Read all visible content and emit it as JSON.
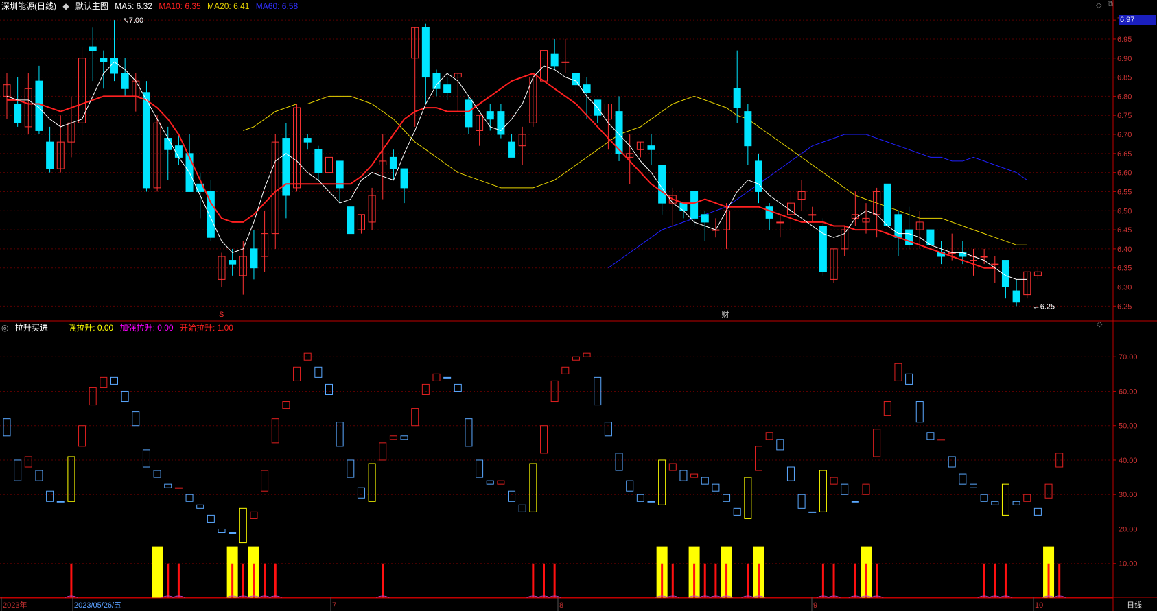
{
  "main_header": {
    "stock_name": "深圳能源(日线)",
    "template_icon": "diamond-icon",
    "template_label": "默认主图",
    "ma5": "MA5: 6.32",
    "ma10": "MA10: 6.35",
    "ma20": "MA20: 6.41",
    "ma60": "MA60: 6.58"
  },
  "indicator_header": {
    "name": "拉升买进",
    "strong": "强拉升: 0.00",
    "extra_strong": "加强拉升: 0.00",
    "start": "开始拉升: 1.00"
  },
  "colors": {
    "up": "#ff3333",
    "down": "#00e5ff",
    "ma5": "#ffffff",
    "ma10": "#ff2020",
    "ma20": "#e6d200",
    "ma60": "#2020ff",
    "ind_up": "#e02020",
    "ind_down": "#5aa8ff",
    "ind_yellow": "#ffff00",
    "ind_red": "#ff1010",
    "grid": "#5a0000",
    "axis": "#c00000",
    "label": "#cc3333"
  },
  "price_axis": {
    "labels": [
      "7.00",
      "6.95",
      "6.90",
      "6.85",
      "6.80",
      "6.75",
      "6.70",
      "6.65",
      "6.60",
      "6.55",
      "6.50",
      "6.45",
      "6.40",
      "6.35",
      "6.30",
      "6.25"
    ],
    "current_price": "6.97"
  },
  "indicator_axis": {
    "labels": [
      "70.00",
      "60.00",
      "50.00",
      "40.00",
      "30.00",
      "20.00",
      "10.00"
    ]
  },
  "annotations": {
    "high": "7.00",
    "low": "6.25",
    "marker_s": "S",
    "marker_cai": "财"
  },
  "date_axis": {
    "labels": [
      "2023年",
      "2023/05/26/五",
      "7",
      "8",
      "9",
      "10"
    ],
    "period": "日线"
  },
  "top_right_icons": [
    "diamond-icon",
    "restore-icon",
    "close-icon"
  ],
  "chart_data": {
    "type": "candlestick",
    "y_range": [
      6.22,
      7.02
    ],
    "candles_ohlc": [
      [
        6.8,
        6.86,
        6.74,
        6.83
      ],
      [
        6.78,
        6.85,
        6.72,
        6.73
      ],
      [
        6.72,
        6.86,
        6.7,
        6.82
      ],
      [
        6.84,
        6.88,
        6.7,
        6.71
      ],
      [
        6.68,
        6.72,
        6.6,
        6.61
      ],
      [
        6.61,
        6.75,
        6.6,
        6.68
      ],
      [
        6.68,
        6.8,
        6.64,
        6.73
      ],
      [
        6.73,
        6.93,
        6.7,
        6.9
      ],
      [
        6.93,
        6.98,
        6.84,
        6.92
      ],
      [
        6.9,
        6.92,
        6.82,
        6.89
      ],
      [
        6.9,
        7.0,
        6.84,
        6.86
      ],
      [
        6.86,
        6.9,
        6.8,
        6.82
      ],
      [
        6.8,
        6.86,
        6.76,
        6.84
      ],
      [
        6.81,
        6.84,
        6.55,
        6.56
      ],
      [
        6.56,
        6.75,
        6.55,
        6.73
      ],
      [
        6.69,
        6.72,
        6.58,
        6.66
      ],
      [
        6.67,
        6.7,
        6.62,
        6.64
      ],
      [
        6.65,
        6.7,
        6.56,
        6.55
      ],
      [
        6.57,
        6.6,
        6.48,
        6.55
      ],
      [
        6.55,
        6.58,
        6.42,
        6.43
      ],
      [
        6.32,
        6.39,
        6.3,
        6.38
      ],
      [
        6.37,
        6.4,
        6.33,
        6.36
      ],
      [
        6.33,
        6.42,
        6.28,
        6.38
      ],
      [
        6.4,
        6.45,
        6.32,
        6.35
      ],
      [
        6.38,
        6.5,
        6.34,
        6.44
      ],
      [
        6.44,
        6.7,
        6.4,
        6.68
      ],
      [
        6.69,
        6.73,
        6.48,
        6.54
      ],
      [
        6.56,
        6.78,
        6.55,
        6.77
      ],
      [
        6.69,
        6.7,
        6.66,
        6.68
      ],
      [
        6.66,
        6.67,
        6.58,
        6.6
      ],
      [
        6.6,
        6.65,
        6.52,
        6.64
      ],
      [
        6.63,
        6.63,
        6.52,
        6.56
      ],
      [
        6.51,
        6.51,
        6.44,
        6.44
      ],
      [
        6.45,
        6.49,
        6.44,
        6.49
      ],
      [
        6.47,
        6.56,
        6.45,
        6.54
      ],
      [
        6.62,
        6.7,
        6.53,
        6.63
      ],
      [
        6.64,
        6.66,
        6.58,
        6.61
      ],
      [
        6.61,
        6.61,
        6.52,
        6.56
      ],
      [
        6.9,
        6.98,
        6.72,
        6.98
      ],
      [
        6.98,
        6.99,
        6.78,
        6.85
      ],
      [
        6.86,
        6.87,
        6.8,
        6.82
      ],
      [
        6.83,
        6.85,
        6.79,
        6.81
      ],
      [
        6.85,
        6.86,
        6.76,
        6.86
      ],
      [
        6.79,
        6.8,
        6.7,
        6.72
      ],
      [
        6.71,
        6.75,
        6.67,
        6.75
      ],
      [
        6.76,
        6.78,
        6.71,
        6.74
      ],
      [
        6.76,
        6.78,
        6.69,
        6.7
      ],
      [
        6.68,
        6.7,
        6.64,
        6.64
      ],
      [
        6.67,
        6.72,
        6.62,
        6.7
      ],
      [
        6.73,
        6.86,
        6.72,
        6.85
      ],
      [
        6.84,
        6.94,
        6.82,
        6.92
      ],
      [
        6.91,
        6.95,
        6.87,
        6.88
      ],
      [
        6.89,
        6.95,
        6.86,
        6.89
      ],
      [
        6.86,
        6.84,
        6.81,
        6.83
      ],
      [
        6.83,
        6.85,
        6.74,
        6.81
      ],
      [
        6.79,
        6.78,
        6.73,
        6.75
      ],
      [
        6.74,
        6.78,
        6.66,
        6.78
      ],
      [
        6.76,
        6.8,
        6.63,
        6.65
      ],
      [
        6.64,
        6.7,
        6.57,
        6.65
      ],
      [
        6.66,
        6.68,
        6.64,
        6.68
      ],
      [
        6.67,
        6.7,
        6.62,
        6.66
      ],
      [
        6.62,
        6.6,
        6.49,
        6.52
      ],
      [
        6.52,
        6.56,
        6.46,
        6.54
      ],
      [
        6.52,
        6.51,
        6.48,
        6.5
      ],
      [
        6.55,
        6.55,
        6.46,
        6.48
      ],
      [
        6.49,
        6.5,
        6.42,
        6.47
      ],
      [
        6.45,
        6.48,
        6.43,
        6.45
      ],
      [
        6.45,
        6.52,
        6.4,
        6.5
      ],
      [
        6.82,
        6.92,
        6.73,
        6.77
      ],
      [
        6.76,
        6.78,
        6.62,
        6.67
      ],
      [
        6.63,
        6.65,
        6.52,
        6.55
      ],
      [
        6.51,
        6.52,
        6.45,
        6.48
      ],
      [
        6.47,
        6.49,
        6.43,
        6.47
      ],
      [
        6.49,
        6.55,
        6.45,
        6.52
      ],
      [
        6.53,
        6.58,
        6.5,
        6.55
      ],
      [
        6.49,
        6.51,
        6.47,
        6.49
      ],
      [
        6.46,
        6.48,
        6.33,
        6.34
      ],
      [
        6.32,
        6.4,
        6.31,
        6.4
      ],
      [
        6.4,
        6.46,
        6.38,
        6.45
      ],
      [
        6.48,
        6.55,
        6.46,
        6.49
      ],
      [
        6.47,
        6.52,
        6.44,
        6.48
      ],
      [
        6.49,
        6.56,
        6.43,
        6.55
      ],
      [
        6.57,
        6.57,
        6.47,
        6.46
      ],
      [
        6.49,
        6.5,
        6.38,
        6.43
      ],
      [
        6.45,
        6.51,
        6.4,
        6.41
      ],
      [
        6.45,
        6.5,
        6.4,
        6.47
      ],
      [
        6.45,
        6.45,
        6.41,
        6.41
      ],
      [
        6.39,
        6.42,
        6.36,
        6.38
      ],
      [
        6.39,
        6.44,
        6.37,
        6.39
      ],
      [
        6.39,
        6.42,
        6.36,
        6.38
      ],
      [
        6.37,
        6.4,
        6.33,
        6.38
      ],
      [
        6.38,
        6.4,
        6.36,
        6.38
      ],
      [
        6.36,
        6.38,
        6.31,
        6.36
      ],
      [
        6.37,
        6.37,
        6.27,
        6.3
      ],
      [
        6.29,
        6.32,
        6.25,
        6.26
      ],
      [
        6.28,
        6.34,
        6.27,
        6.34
      ],
      [
        6.33,
        6.35,
        6.32,
        6.34
      ]
    ],
    "ma5": [
      6.8,
      6.79,
      6.79,
      6.77,
      6.74,
      6.72,
      6.73,
      6.74,
      6.8,
      6.86,
      6.89,
      6.87,
      6.84,
      6.79,
      6.74,
      6.69,
      6.64,
      6.6,
      6.54,
      6.48,
      6.42,
      6.39,
      6.4,
      6.47,
      6.56,
      6.63,
      6.65,
      6.63,
      6.6,
      6.58,
      6.55,
      6.52,
      6.53,
      6.58,
      6.6,
      6.59,
      6.58,
      6.65,
      6.71,
      6.78,
      6.83,
      6.86,
      6.84,
      6.8,
      6.76,
      6.72,
      6.71,
      6.74,
      6.78,
      6.85,
      6.88,
      6.87,
      6.85,
      6.84,
      6.8,
      6.77,
      6.73,
      6.7,
      6.67,
      6.63,
      6.6,
      6.56,
      6.52,
      6.5,
      6.47,
      6.46,
      6.45,
      6.5,
      6.55,
      6.58,
      6.57,
      6.54,
      6.52,
      6.5,
      6.48,
      6.46,
      6.44,
      6.43,
      6.44,
      6.48,
      6.5,
      6.49,
      6.46,
      6.44,
      6.44,
      6.43,
      6.41,
      6.4,
      6.39,
      6.39,
      6.38,
      6.37,
      6.35,
      6.33,
      6.32,
      6.32
    ],
    "ma10": [
      6.79,
      6.79,
      6.78,
      6.78,
      6.77,
      6.76,
      6.77,
      6.78,
      6.79,
      6.8,
      6.8,
      6.8,
      6.8,
      6.79,
      6.77,
      6.74,
      6.7,
      6.64,
      6.58,
      6.52,
      6.48,
      6.47,
      6.47,
      6.49,
      6.52,
      6.55,
      6.57,
      6.57,
      6.57,
      6.57,
      6.57,
      6.57,
      6.57,
      6.59,
      6.62,
      6.66,
      6.7,
      6.74,
      6.76,
      6.77,
      6.77,
      6.76,
      6.76,
      6.76,
      6.78,
      6.8,
      6.82,
      6.84,
      6.85,
      6.86,
      6.84,
      6.82,
      6.8,
      6.78,
      6.75,
      6.72,
      6.69,
      6.66,
      6.63,
      6.6,
      6.57,
      6.55,
      6.53,
      6.52,
      6.52,
      6.53,
      6.52,
      6.51,
      6.51,
      6.51,
      6.51,
      6.5,
      6.49,
      6.48,
      6.47,
      6.47,
      6.47,
      6.46,
      6.46,
      6.45,
      6.45,
      6.45,
      6.44,
      6.43,
      6.42,
      6.41,
      6.4,
      6.39,
      6.38,
      6.37,
      6.36,
      6.35,
      6.35
    ],
    "ma20": [
      6.71,
      6.72,
      6.74,
      6.76,
      6.77,
      6.78,
      6.78,
      6.79,
      6.8,
      6.8,
      6.8,
      6.79,
      6.78,
      6.76,
      6.74,
      6.71,
      6.68,
      6.66,
      6.64,
      6.62,
      6.6,
      6.59,
      6.58,
      6.57,
      6.56,
      6.56,
      6.56,
      6.56,
      6.57,
      6.58,
      6.6,
      6.62,
      6.64,
      6.66,
      6.68,
      6.7,
      6.71,
      6.72,
      6.74,
      6.76,
      6.78,
      6.79,
      6.8,
      6.79,
      6.78,
      6.77,
      6.75,
      6.74,
      6.72,
      6.7,
      6.68,
      6.66,
      6.64,
      6.62,
      6.6,
      6.58,
      6.56,
      6.54,
      6.53,
      6.52,
      6.51,
      6.5,
      6.49,
      6.48,
      6.48,
      6.48,
      6.47,
      6.46,
      6.45,
      6.44,
      6.43,
      6.42,
      6.41,
      6.41
    ],
    "ma60": [
      6.35,
      6.37,
      6.39,
      6.41,
      6.43,
      6.45,
      6.46,
      6.47,
      6.48,
      6.49,
      6.5,
      6.51,
      6.53,
      6.55,
      6.57,
      6.59,
      6.61,
      6.63,
      6.65,
      6.67,
      6.68,
      6.69,
      6.7,
      6.7,
      6.7,
      6.69,
      6.68,
      6.67,
      6.66,
      6.65,
      6.64,
      6.64,
      6.63,
      6.63,
      6.64,
      6.63,
      6.62,
      6.61,
      6.6,
      6.58
    ],
    "indicator": {
      "y_range": [
        0,
        78
      ],
      "boxes_open_close_kind": [
        [
          52,
          47,
          "d"
        ],
        [
          34,
          40,
          "d"
        ],
        [
          41,
          38,
          "u"
        ],
        [
          37,
          34,
          "d"
        ],
        [
          31,
          28,
          "d"
        ],
        [
          28,
          28,
          "d"
        ],
        [
          28,
          41,
          "y"
        ],
        [
          44,
          50,
          "u"
        ],
        [
          56,
          61,
          "u"
        ],
        [
          61,
          64,
          "u"
        ],
        [
          64,
          62,
          "d"
        ],
        [
          60,
          57,
          "d"
        ],
        [
          54,
          50,
          "d"
        ],
        [
          43,
          38,
          "d"
        ],
        [
          37,
          35,
          "d"
        ],
        [
          33,
          32,
          "d"
        ],
        [
          32,
          32,
          "u"
        ],
        [
          30,
          28,
          "d"
        ],
        [
          27,
          26,
          "d"
        ],
        [
          24,
          22,
          "d"
        ],
        [
          20,
          19,
          "d"
        ],
        [
          19,
          19,
          "d"
        ],
        [
          16,
          26,
          "y"
        ],
        [
          23,
          25,
          "u"
        ],
        [
          31,
          37,
          "u"
        ],
        [
          45,
          52,
          "u"
        ],
        [
          55,
          57,
          "u"
        ],
        [
          63,
          67,
          "u"
        ],
        [
          69,
          71,
          "u"
        ],
        [
          67,
          64,
          "d"
        ],
        [
          62,
          59,
          "d"
        ],
        [
          51,
          44,
          "d"
        ],
        [
          40,
          35,
          "d"
        ],
        [
          32,
          29,
          "d"
        ],
        [
          28,
          39,
          "y"
        ],
        [
          40,
          45,
          "u"
        ],
        [
          46,
          47,
          "u"
        ],
        [
          47,
          46,
          "d"
        ],
        [
          50,
          55,
          "u"
        ],
        [
          59,
          62,
          "u"
        ],
        [
          63,
          65,
          "u"
        ],
        [
          64,
          64,
          "d"
        ],
        [
          62,
          60,
          "d"
        ],
        [
          52,
          44,
          "d"
        ],
        [
          40,
          35,
          "d"
        ],
        [
          34,
          33,
          "d"
        ],
        [
          33,
          34,
          "u"
        ],
        [
          31,
          28,
          "d"
        ],
        [
          27,
          25,
          "d"
        ],
        [
          25,
          39,
          "y"
        ],
        [
          42,
          50,
          "u"
        ],
        [
          57,
          63,
          "u"
        ],
        [
          65,
          67,
          "u"
        ],
        [
          69,
          70,
          "u"
        ],
        [
          70,
          71,
          "u"
        ],
        [
          64,
          56,
          "d"
        ],
        [
          51,
          47,
          "d"
        ],
        [
          42,
          37,
          "d"
        ],
        [
          34,
          31,
          "d"
        ],
        [
          30,
          28,
          "d"
        ],
        [
          28,
          28,
          "d"
        ],
        [
          27,
          40,
          "y"
        ],
        [
          37,
          39,
          "u"
        ],
        [
          37,
          34,
          "d"
        ],
        [
          35,
          36,
          "u"
        ],
        [
          35,
          33,
          "d"
        ],
        [
          33,
          31,
          "d"
        ],
        [
          30,
          28,
          "d"
        ],
        [
          26,
          24,
          "d"
        ],
        [
          23,
          35,
          "y"
        ],
        [
          37,
          44,
          "u"
        ],
        [
          46,
          48,
          "u"
        ],
        [
          46,
          43,
          "d"
        ],
        [
          38,
          34,
          "d"
        ],
        [
          30,
          26,
          "d"
        ],
        [
          25,
          25,
          "d"
        ],
        [
          25,
          37,
          "y"
        ],
        [
          33,
          35,
          "u"
        ],
        [
          33,
          30,
          "d"
        ],
        [
          28,
          28,
          "d"
        ],
        [
          30,
          33,
          "u"
        ],
        [
          41,
          49,
          "u"
        ],
        [
          53,
          57,
          "u"
        ],
        [
          63,
          68,
          "u"
        ],
        [
          65,
          62,
          "d"
        ],
        [
          57,
          51,
          "d"
        ],
        [
          48,
          46,
          "d"
        ],
        [
          46,
          46,
          "u"
        ],
        [
          41,
          38,
          "d"
        ],
        [
          36,
          33,
          "d"
        ],
        [
          33,
          32,
          "d"
        ],
        [
          30,
          28,
          "d"
        ],
        [
          28,
          27,
          "d"
        ],
        [
          24,
          33,
          "y"
        ],
        [
          28,
          27,
          "d"
        ],
        [
          28,
          30,
          "u"
        ],
        [
          26,
          24,
          "d"
        ],
        [
          29,
          33,
          "u"
        ],
        [
          38,
          42,
          "u"
        ]
      ],
      "strong_bars_yellow": [
        14,
        21,
        23,
        61,
        64,
        67,
        70,
        80,
        97
      ],
      "signal_bars_red": [
        6,
        15,
        16,
        21,
        22,
        23,
        24,
        25,
        35,
        49,
        50,
        51,
        61,
        62,
        64,
        65,
        66,
        67,
        69,
        70,
        76,
        77,
        79,
        80,
        81,
        91,
        92,
        93,
        97,
        98
      ]
    }
  }
}
